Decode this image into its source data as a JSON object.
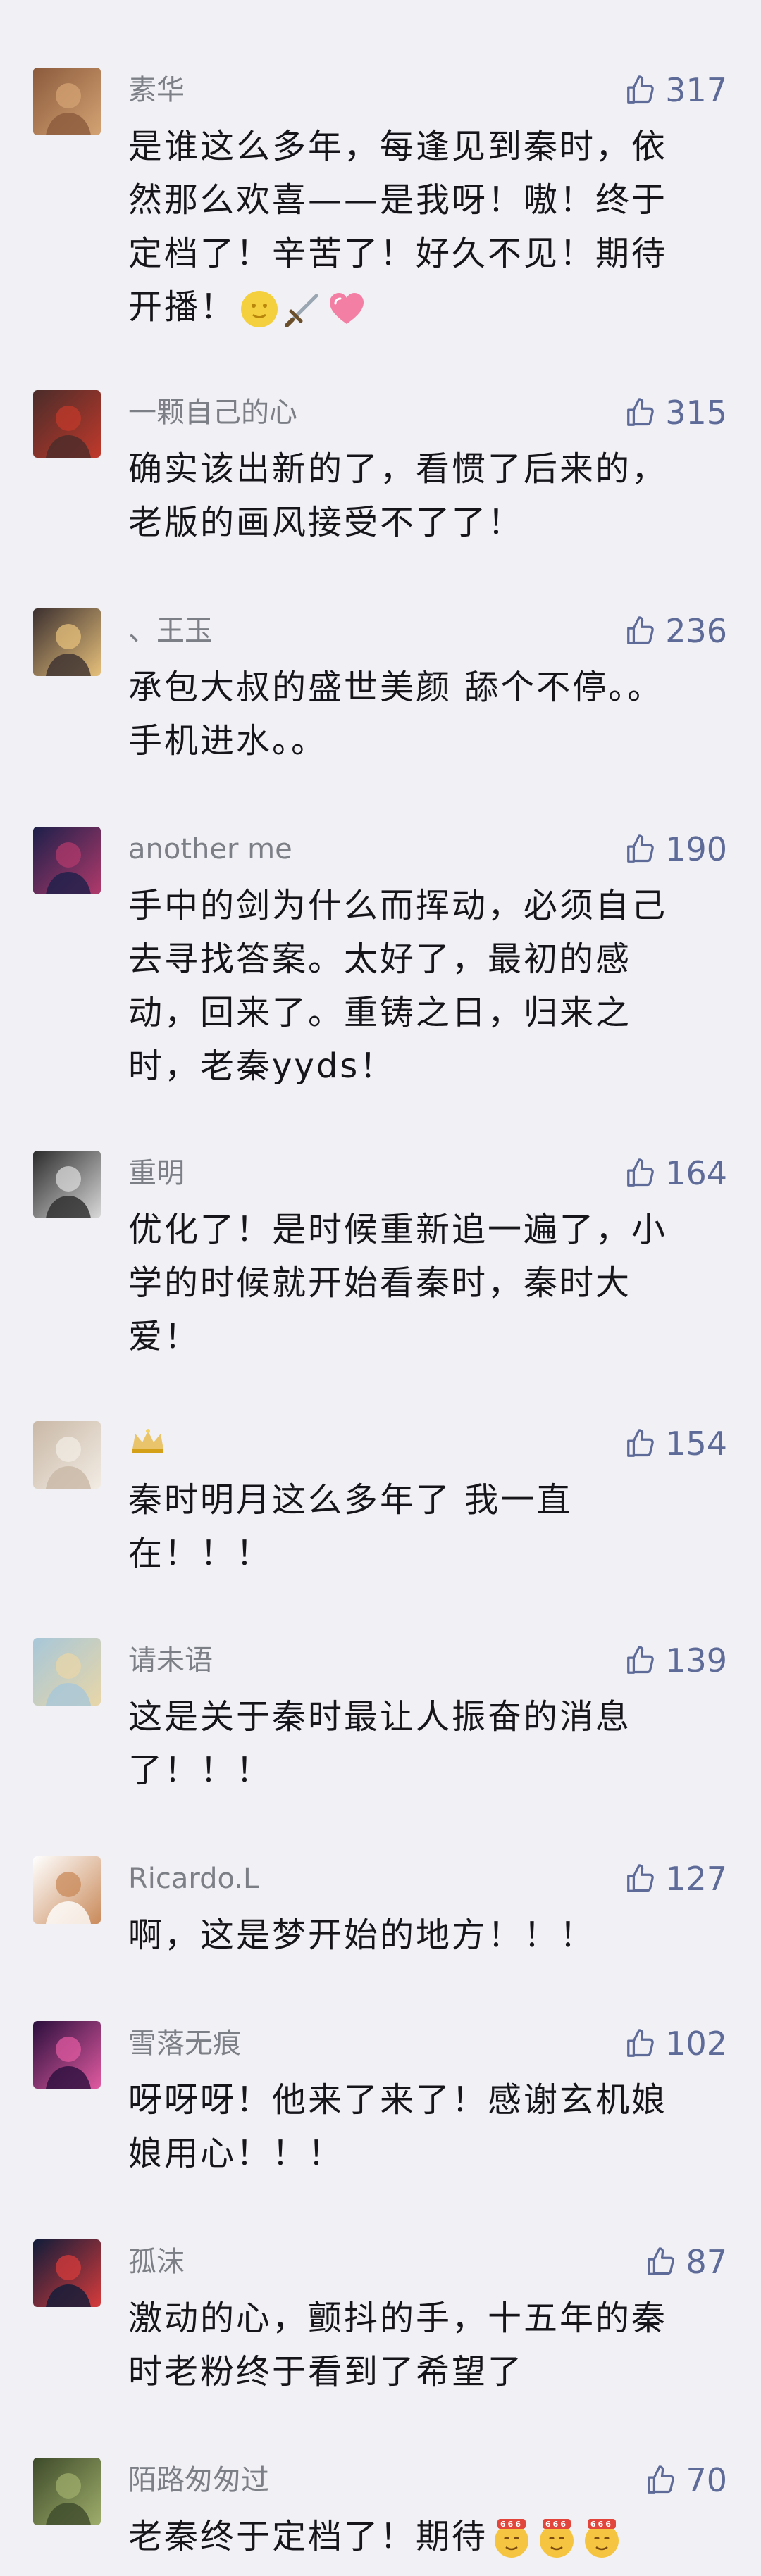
{
  "comments": [
    {
      "user": "素华",
      "likes": "317",
      "text": "是谁这么多年，每逢见到秦时，依\n然那么欢喜——是我呀！嗷！终于\n定档了！辛苦了！好久不见！期待\n开播！",
      "emojis": [
        "moon-emoji",
        "sword-emoji",
        "heart-emoji"
      ],
      "avatar_colors": [
        "#8b5a3c",
        "#d4a373"
      ]
    },
    {
      "user": "一颗自己的心",
      "likes": "315",
      "text": "确实该出新的了，看惯了后来的，\n老版的画风接受不了了！",
      "avatar_colors": [
        "#4a2c2a",
        "#c0392b"
      ]
    },
    {
      "user": "、王玉",
      "likes": "236",
      "text": "承包大叔的盛世美颜 舔个不停。。\n手机进水。。",
      "avatar_colors": [
        "#3b2f2f",
        "#e6c07b"
      ]
    },
    {
      "user": "another me",
      "likes": "190",
      "text": "手中的剑为什么而挥动，必须自己\n去寻找答案。太好了，最初的感\n动，回来了。重铸之日，归来之\n时，老秦yyds！",
      "avatar_colors": [
        "#1c1f4a",
        "#b03a6b"
      ]
    },
    {
      "user": "重明",
      "likes": "164",
      "text": "优化了！是时候重新追一遍了，小\n学的时候就开始看秦时，秦时大\n爱！",
      "avatar_colors": [
        "#2b2b2b",
        "#d9d9d9"
      ]
    },
    {
      "user": "",
      "likes": "154",
      "text": "秦时明月这么多年了  我一直\n在！！！",
      "avatar_colors": [
        "#c9b8a6",
        "#f2ece4"
      ]
    },
    {
      "user": "请未语",
      "likes": "139",
      "text": "这是关于秦时最让人振奋的消息\n了！！！",
      "avatar_colors": [
        "#a7c7d9",
        "#e8d6a8"
      ]
    },
    {
      "user": "Ricardo.L",
      "likes": "127",
      "text": "啊，这是梦开始的地方！！！",
      "avatar_colors": [
        "#ffffff",
        "#c98a5a"
      ]
    },
    {
      "user": "雪落无痕",
      "likes": "102",
      "text": "呀呀呀！他来了来了！感谢玄机娘\n娘用心！！！",
      "avatar_colors": [
        "#2a0f3d",
        "#e05aa0"
      ]
    },
    {
      "user": "孤沫",
      "likes": "87",
      "text": "激动的心，颤抖的手，十五年的秦\n时老粉终于看到了希望了",
      "avatar_colors": [
        "#0f1c3a",
        "#d63b3b"
      ]
    },
    {
      "user": "陌路匆匆过",
      "likes": "70",
      "text": "老秦终于定档了！期待",
      "emojis": [
        "666-emoji",
        "666-emoji",
        "666-emoji"
      ],
      "avatar_colors": [
        "#3d4a2a",
        "#9fae6b"
      ]
    }
  ],
  "colors": {
    "background": "#f1f1f5",
    "username": "#7d7f87",
    "like": "#5e6b98",
    "text": "#16161a"
  }
}
